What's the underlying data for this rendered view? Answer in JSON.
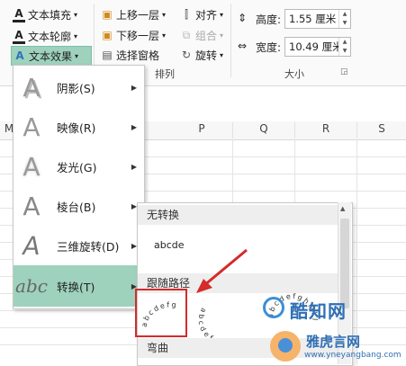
{
  "ribbon": {
    "text_fill": "文本填充",
    "text_outline": "文本轮廓",
    "text_effects": "文本效果",
    "bring_forward": "上移一层",
    "send_backward": "下移一层",
    "selection_pane": "选择窗格",
    "align": "对齐",
    "group": "组合",
    "rotate": "旋转",
    "group_arrange": "排列",
    "height_label": "高度:",
    "height_value": "1.55 厘米",
    "width_label": "宽度:",
    "width_value": "10.49 厘米",
    "group_size": "大小",
    "accent_color": "#2e75b6"
  },
  "columns": [
    "M",
    "P",
    "Q",
    "R",
    "S"
  ],
  "effects_menu": {
    "items": [
      {
        "label": "阴影(S)",
        "icon": "shadow-a-icon"
      },
      {
        "label": "映像(R)",
        "icon": "reflection-a-icon"
      },
      {
        "label": "发光(G)",
        "icon": "glow-a-icon"
      },
      {
        "label": "棱台(B)",
        "icon": "bevel-a-icon"
      },
      {
        "label": "三维旋转(D)",
        "icon": "3d-rotation-a-icon"
      },
      {
        "label": "转换(T)",
        "icon": "abc-transform-icon"
      }
    ],
    "selected_index": 5,
    "selected_color": "#9ed2bd",
    "glyph_a": "A",
    "glyph_abc": "abc"
  },
  "transform_panel": {
    "no_transform": "无转换",
    "sample_text": "abcde",
    "follow_path": "跟随路径",
    "arc_up_text": "abcdefg",
    "arc_down_text": "abcdefg",
    "circle_text": "abcdefghijkl",
    "warp": "弯曲"
  },
  "watermark": {
    "brand_cn": "酷知网",
    "brand2_cn": "雅虎言网",
    "url": "www.yneyangbang.com"
  },
  "highlight_color": "#d42b2b"
}
